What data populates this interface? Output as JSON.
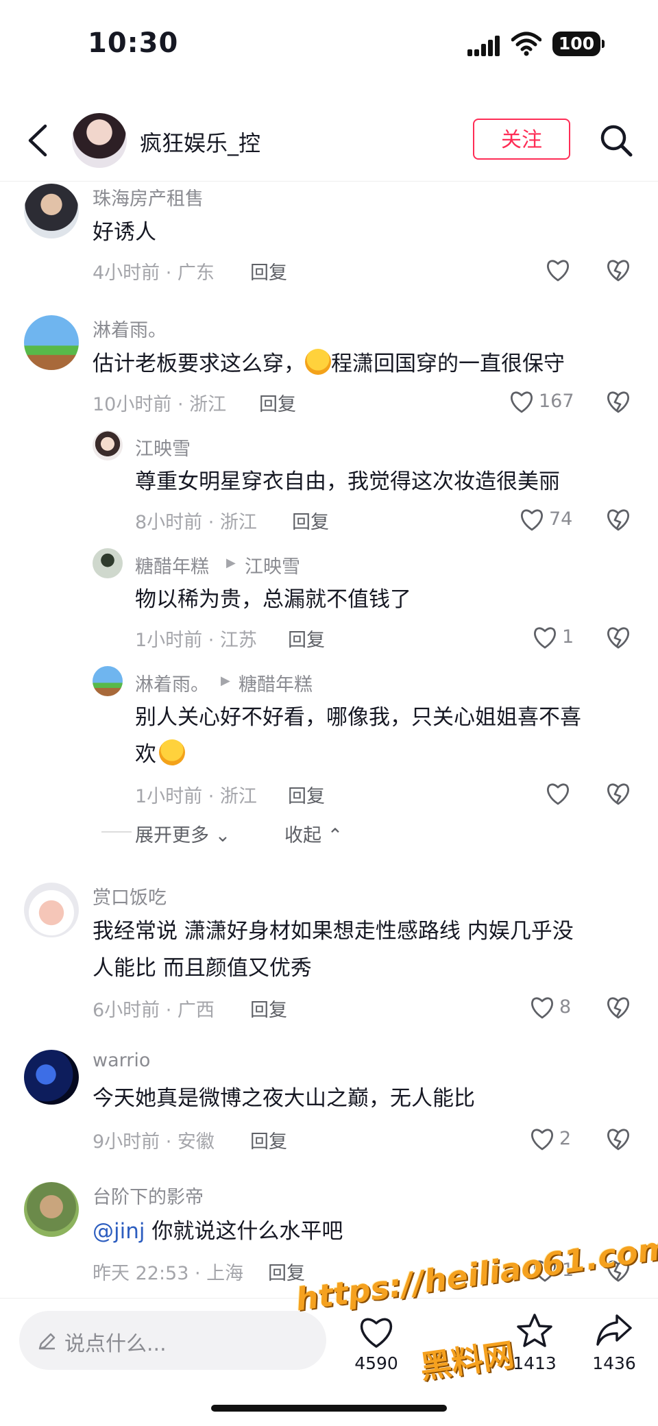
{
  "status_bar": {
    "time": "10:30",
    "battery": "100"
  },
  "header": {
    "title": "疯狂娱乐_控",
    "follow_label": "关注"
  },
  "comments": [
    {
      "user": "珠海房产租售",
      "text": "好诱人",
      "time": "4小时前 · 广东",
      "reply": "回复",
      "likes": ""
    },
    {
      "user": "淋着雨。",
      "text_a": "估计老板要求这么穿，",
      "text_b": "程潇回国穿的一直很保守",
      "time": "10小时前 · 浙江",
      "reply": "回复",
      "likes": "167"
    },
    {
      "user": "赏口饭吃",
      "text_l1": "我经常说  潇潇好身材如果想走性感路线  内娱几乎没",
      "text_l2": "人能比  而且颜值又优秀",
      "time": "6小时前 · 广西",
      "reply": "回复",
      "likes": "8"
    },
    {
      "user": "warrio",
      "text": "今天她真是微博之夜大山之巅，无人能比",
      "time": "9小时前 · 安徽",
      "reply": "回复",
      "likes": "2"
    },
    {
      "user": "台阶下的影帝",
      "mention": "@jinj",
      "text": " 你就说这什么水平吧",
      "time": "昨天 22:53 · 上海",
      "reply": "回复",
      "likes": "1"
    }
  ],
  "replies": [
    {
      "user": "江映雪",
      "reply_to": "",
      "text": "尊重女明星穿衣自由，我觉得这次妆造很美丽",
      "time": "8小时前 · 浙江",
      "reply": "回复",
      "likes": "74"
    },
    {
      "user": "糖醋年糕",
      "reply_to": "江映雪",
      "text": "物以稀为贵，总漏就不值钱了",
      "time": "1小时前 · 江苏",
      "reply": "回复",
      "likes": "1"
    },
    {
      "user": "淋着雨。",
      "reply_to": "糖醋年糕",
      "text_l1": "别人关心好不好看，哪像我，只关心姐姐喜不喜",
      "text_l2": "欢",
      "time": "1小时前 · 浙江",
      "reply": "回复",
      "likes": ""
    }
  ],
  "thread_controls": {
    "expand": "展开更多",
    "collapse": "收起"
  },
  "bottom_bar": {
    "placeholder": "说点什么...",
    "like_count": "4590",
    "fav_count": "1413",
    "share_count": "1436"
  },
  "watermark": {
    "line1": "https://heiliao61.com",
    "line2": "黑料网"
  },
  "colors": {
    "accent": "#fe2c55",
    "mention": "#2c5dbf",
    "watermark": "#f5a11f"
  }
}
